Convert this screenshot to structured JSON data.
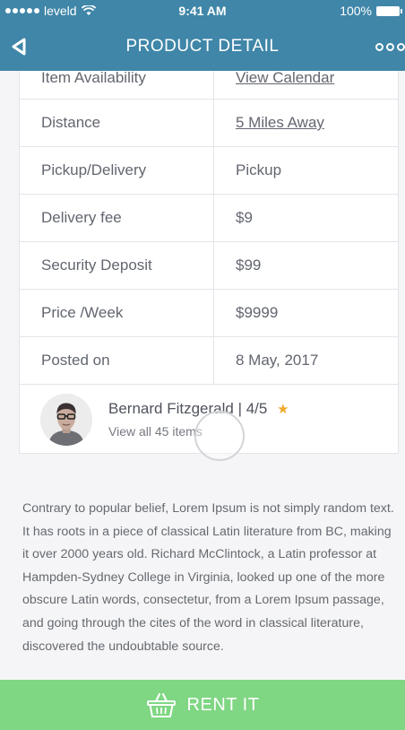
{
  "status_bar": {
    "carrier": "leveld",
    "time": "9:41 AM",
    "battery": "100%"
  },
  "nav": {
    "title": "PRODUCT DETAIL",
    "back_icon": "back-arrow-icon",
    "more_icon": "more-dots-icon"
  },
  "details": [
    {
      "label": "Item Availability",
      "value": "View Calendar",
      "link": true
    },
    {
      "label": "Distance",
      "value": "5 Miles Away",
      "link": true
    },
    {
      "label": "Pickup/Delivery",
      "value": "Pickup",
      "link": false
    },
    {
      "label": "Delivery fee",
      "value": "$9",
      "link": false
    },
    {
      "label": "Security Deposit",
      "value": "$99",
      "link": false
    },
    {
      "label": "Price /Week",
      "value": "$9999",
      "link": false
    },
    {
      "label": "Posted on",
      "value": "8 May, 2017",
      "link": false
    }
  ],
  "owner": {
    "name": "Bernard Fitzgerald",
    "rating": "| 4/5",
    "view_items": "View all 45 items"
  },
  "description": "Contrary to popular belief, Lorem Ipsum is not simply random text. It has roots in a piece of classical Latin literature from BC, making it over 2000 years old. Richard McClintock, a Latin professor at Hampden-Sydney College in Virginia, looked up one of the more obscure Latin words, consectetur, from a Lorem Ipsum passage, and going through the cites of the word in classical literature, discovered the undoubtable source.",
  "rent_button": {
    "label": "RENT IT",
    "icon": "basket-icon"
  },
  "colors": {
    "header": "#3f86a8",
    "rent_button": "#7fd683",
    "star": "#f0a92a"
  }
}
